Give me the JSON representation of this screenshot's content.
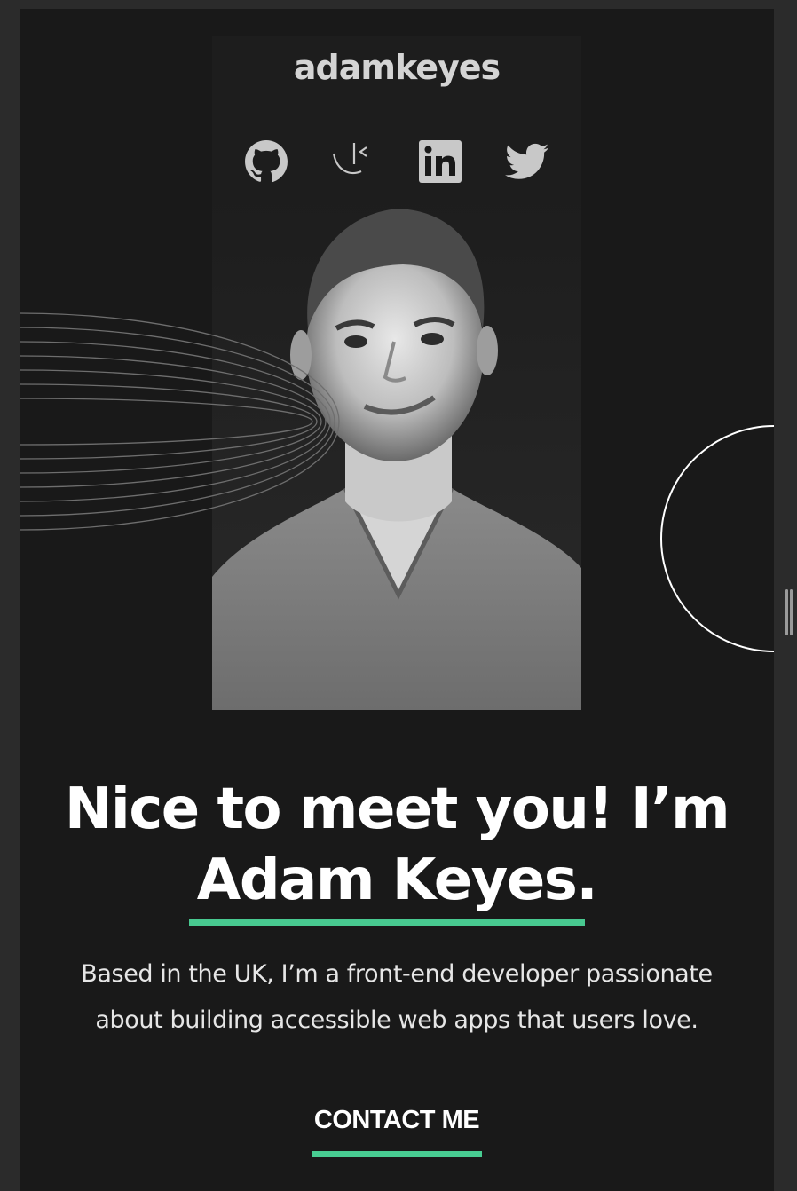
{
  "header": {
    "brand": "adamkeyes"
  },
  "socials": [
    {
      "name": "github-icon"
    },
    {
      "name": "frontend-mentor-icon"
    },
    {
      "name": "linkedin-icon"
    },
    {
      "name": "twitter-icon"
    }
  ],
  "hero": {
    "headline_line1": "Nice to meet you! I’m",
    "headline_name": "Adam Keyes.",
    "bio_line1": "Based in the UK, I’m a front-end developer passionate",
    "bio_line2": "about building accessible web apps that users love.",
    "cta_label": "CONTACT ME"
  },
  "colors": {
    "background": "#191919",
    "accent": "#4ee1a0",
    "text": "#ffffff",
    "icon": "#c8c8c8"
  }
}
